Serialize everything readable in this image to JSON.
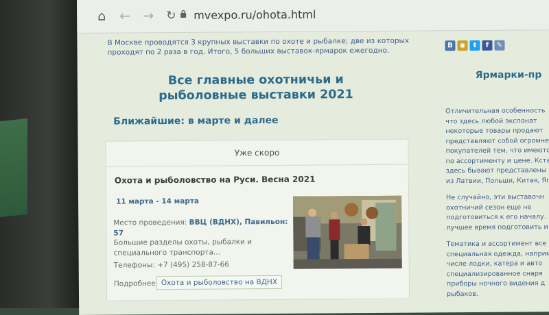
{
  "browser": {
    "url": "mvexpo.ru/ohota.html",
    "icons": [
      "home-icon",
      "back-icon",
      "forward-icon",
      "reload-icon",
      "lock-icon"
    ]
  },
  "intro": "В Москве проводятся 3 крупных выставки по охоте и рыбалке; две из которых проходят по 2 раза в год. Итого, 5 больших выставок-ярмарок ежегодно.",
  "main": {
    "heading": "Все главные охотничьи и рыболовные выставки 2021",
    "subheading": "Ближайшие: в марте и далее"
  },
  "card": {
    "header": "Уже скоро",
    "title": "Охота и рыболовство на Руси. Весна 2021",
    "dates": "11 марта - 14 марта",
    "place_label": "Место проведения: ",
    "place_value": "ВВЦ (ВДНХ), Павильон: 57",
    "description": "Большие разделы охоты, рыбалки и специального транспорта...",
    "phone": "Телефоны: +7 (495) 258-87-66",
    "more_label": "Подробнее:",
    "more_link": "Охота и рыболовство на ВДНХ"
  },
  "social": [
    {
      "name": "vk-icon",
      "glyph": "В",
      "color": "#4a76a8"
    },
    {
      "name": "ok-icon",
      "glyph": "◉",
      "color": "#c9a227"
    },
    {
      "name": "twitter-icon",
      "glyph": "t",
      "color": "#1da1f2"
    },
    {
      "name": "facebook-icon",
      "glyph": "f",
      "color": "#3b5998"
    },
    {
      "name": "livejournal-icon",
      "glyph": "✎",
      "color": "#6f8db5"
    }
  ],
  "sidebar": {
    "title": "Ярмарки-пр",
    "paragraphs": [
      [
        "Отличительная особенность",
        "что здесь любой экспонат",
        "некоторые товары продают",
        "представляют собой огромне",
        "покупателей тем, что имеются",
        "по ассортименту и цене. Кста",
        "здесь бывают представлены",
        "из Латвии, Польши, Китая, Яп"
      ],
      [
        "Не случайно, эти выставочн",
        "охотничий сезон еще не",
        "подготовиться к его началу.",
        "лучшее время подготовить и"
      ],
      [
        "Тематика и ассортимент все",
        "специальная одежда, наприм",
        "числе лодки, катера и авто",
        "специализированное снаря",
        "приборы ночного видения д",
        "рыбаков."
      ]
    ]
  }
}
